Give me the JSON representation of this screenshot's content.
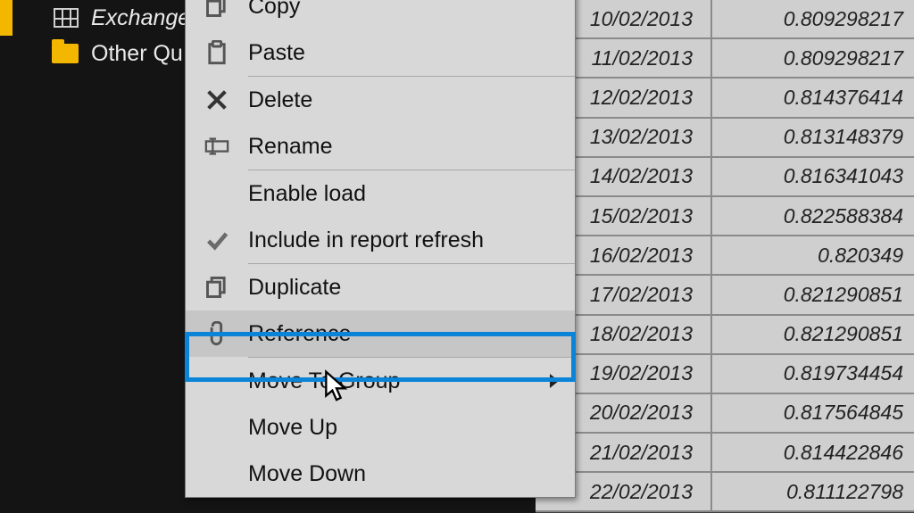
{
  "sidebar": {
    "items": [
      {
        "label": "Exchange Rates",
        "icon": "table"
      },
      {
        "label": "Other Qu",
        "icon": "folder"
      }
    ]
  },
  "table": {
    "rows": [
      {
        "date": "10/02/2013",
        "value": "0.809298217"
      },
      {
        "date": "11/02/2013",
        "value": "0.809298217"
      },
      {
        "date": "12/02/2013",
        "value": "0.814376414"
      },
      {
        "date": "13/02/2013",
        "value": "0.813148379"
      },
      {
        "date": "14/02/2013",
        "value": "0.816341043"
      },
      {
        "date": "15/02/2013",
        "value": "0.822588384"
      },
      {
        "date": "16/02/2013",
        "value": "0.820349"
      },
      {
        "date": "17/02/2013",
        "value": "0.821290851"
      },
      {
        "date": "18/02/2013",
        "value": "0.821290851"
      },
      {
        "date": "19/02/2013",
        "value": "0.819734454"
      },
      {
        "date": "20/02/2013",
        "value": "0.817564845"
      },
      {
        "date": "21/02/2013",
        "value": "0.814422846"
      },
      {
        "date": "22/02/2013",
        "value": "0.811122798"
      }
    ]
  },
  "contextMenu": {
    "items": [
      {
        "label": "Copy",
        "icon": "copy"
      },
      {
        "label": "Paste",
        "icon": "paste"
      },
      {
        "sep": true
      },
      {
        "label": "Delete",
        "icon": "x"
      },
      {
        "label": "Rename",
        "icon": "cursor-text"
      },
      {
        "sep": true
      },
      {
        "label": "Enable load",
        "icon": ""
      },
      {
        "label": "Include in report refresh",
        "icon": "check"
      },
      {
        "sep": true
      },
      {
        "label": "Duplicate",
        "icon": "copy"
      },
      {
        "label": "Reference",
        "icon": "clip",
        "highlight": true
      },
      {
        "sep": true
      },
      {
        "label": "Move To Group",
        "submenu": true
      },
      {
        "label": "Move Up"
      },
      {
        "label": "Move Down"
      }
    ]
  }
}
